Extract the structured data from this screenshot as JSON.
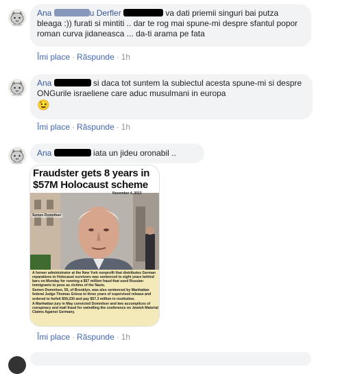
{
  "comments": [
    {
      "author": "Ana",
      "author_mid": "u Derfler",
      "text": "va dati priemii singuri bai putza bleaga :)) furati si mintiti .. dar te rog mai spune-mi despre sfantul popor roman curva jidaneasca ... da-ti arama pe fata",
      "like": "Îmi place",
      "reply": "Răspunde",
      "time": "1h"
    },
    {
      "author": "Ana",
      "text": "si daca tot suntem la subiectul acesta spune-mi si despre ONGurile israeliene care aduc musulmani in europa",
      "emoji": "😉",
      "like": "Îmi place",
      "reply": "Răspunde",
      "time": "1h"
    },
    {
      "author": "Ana",
      "text": "iata un jideu oronabil ..",
      "like": "Îmi place",
      "reply": "Răspunde",
      "time": "1h",
      "attachment": {
        "headline": "Fraudster gets 8 years in $57M Holocaust scheme",
        "date": "November 4, 2013",
        "caption": "Semen Domnitser",
        "body": [
          "A former administrator at the New York nonprofit that distributes German reparations to Holocaust survivors was sentenced to eight years behind bars on Monday for running a $57 million fraud that used Russian immigrants to pose as victims of the Nazis.",
          "Semen Domnitser, 55, of Brooklyn, was also sentenced by Manhattan federal Judge Thomas Griesa to three years of supervised release and ordered to forfeit $59,230 and pay $57.3 million in restitution.",
          "A Manhattan jury in May convicted Domnitser and two accomplices of conspiracy and mail fraud for swindling the conference on Jewish Material Claims Against Germany."
        ]
      }
    }
  ]
}
